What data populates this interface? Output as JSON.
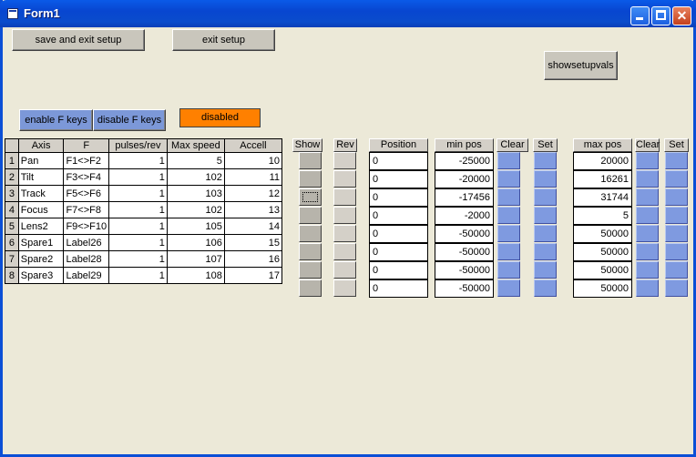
{
  "window": {
    "title": "Form1"
  },
  "buttons": {
    "save_exit": "save and exit setup",
    "exit_setup": "exit setup",
    "showsetupvals": "showsetupvals",
    "enable_f": "enable F keys",
    "disable_f": "disable F keys"
  },
  "status": "disabled",
  "headers": {
    "axis": "Axis",
    "f": "F",
    "pulses": "pulses/rev",
    "maxspeed": "Max speed",
    "accel": "Accell",
    "show": "Show",
    "rev": "Rev",
    "position": "Position",
    "minpos": "min pos",
    "clear1": "Clear",
    "set1": "Set",
    "maxpos": "max pos",
    "clear2": "Clear",
    "set2": "Set"
  },
  "rows": [
    {
      "idx": "1",
      "axis": "Pan",
      "f": "F1<>F2",
      "pulses": "1",
      "maxspeed": "5",
      "accel": "10",
      "position": "0",
      "minpos": "-25000",
      "maxpos": "20000"
    },
    {
      "idx": "2",
      "axis": "Tilt",
      "f": "F3<>F4",
      "pulses": "1",
      "maxspeed": "102",
      "accel": "11",
      "position": "0",
      "minpos": "-20000",
      "maxpos": "16261"
    },
    {
      "idx": "3",
      "axis": "Track",
      "f": "F5<>F6",
      "pulses": "1",
      "maxspeed": "103",
      "accel": "12",
      "position": "0",
      "minpos": "-17456",
      "maxpos": "31744"
    },
    {
      "idx": "4",
      "axis": "Focus",
      "f": "F7<>F8",
      "pulses": "1",
      "maxspeed": "102",
      "accel": "13",
      "position": "0",
      "minpos": "-2000",
      "maxpos": "5"
    },
    {
      "idx": "5",
      "axis": "Lens2",
      "f": "F9<>F10",
      "pulses": "1",
      "maxspeed": "105",
      "accel": "14",
      "position": "0",
      "minpos": "-50000",
      "maxpos": "50000"
    },
    {
      "idx": "6",
      "axis": "Spare1",
      "f": "Label26",
      "pulses": "1",
      "maxspeed": "106",
      "accel": "15",
      "position": "0",
      "minpos": "-50000",
      "maxpos": "50000"
    },
    {
      "idx": "7",
      "axis": "Spare2",
      "f": "Label28",
      "pulses": "1",
      "maxspeed": "107",
      "accel": "16",
      "position": "0",
      "minpos": "-50000",
      "maxpos": "50000"
    },
    {
      "idx": "8",
      "axis": "Spare3",
      "f": "Label29",
      "pulses": "1",
      "maxspeed": "108",
      "accel": "17",
      "position": "0",
      "minpos": "-50000",
      "maxpos": "50000"
    }
  ]
}
